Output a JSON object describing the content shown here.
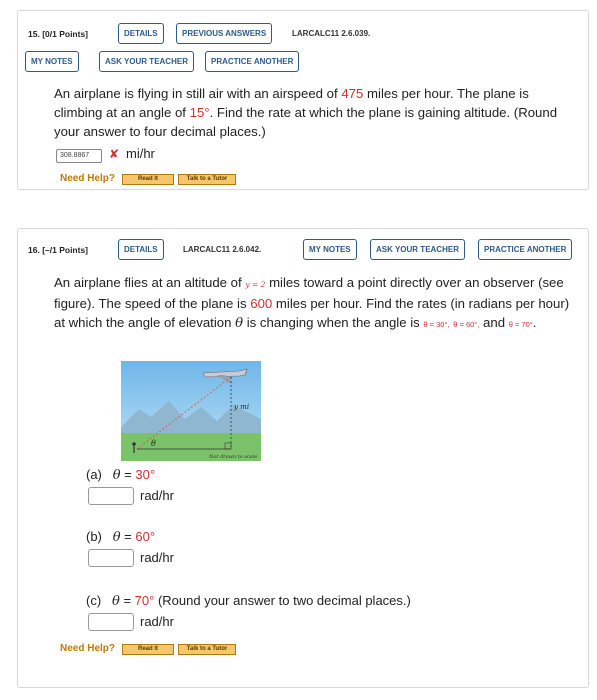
{
  "q15": {
    "number": "15.",
    "points": "[0/1 Points]",
    "buttons": {
      "details": "DETAILS",
      "previous_answers": "PREVIOUS ANSWERS",
      "my_notes": "MY NOTES",
      "ask_teacher": "ASK YOUR TEACHER",
      "practice_another": "PRACTICE ANOTHER"
    },
    "code": "LARCALC11 2.6.039.",
    "text": {
      "p1": "An airplane is flying in still air with an airspeed of ",
      "speed": "475",
      "p2": " miles per hour. The plane is climbing at an angle of ",
      "angle": "15°",
      "p3": ". Find the rate at which the plane is gaining altitude. (Round your answer to four decimal places.)"
    },
    "answer_value": "308.8867",
    "wrong_mark": "✘",
    "unit": "mi/hr",
    "need_help": "Need Help?",
    "read_it": "Read It",
    "talk_tutor": "Talk to a Tutor"
  },
  "q16": {
    "number": "16.",
    "points": "[–/1 Points]",
    "buttons": {
      "details": "DETAILS",
      "my_notes": "MY NOTES",
      "ask_teacher": "ASK YOUR TEACHER",
      "practice_another": "PRACTICE ANOTHER"
    },
    "code": "LARCALC11 2.6.042.",
    "text": {
      "p1": "An airplane flies at an altitude of ",
      "alt_eq": "y = 2",
      "p2": " miles toward a point directly over an observer (see figure). The speed of the plane is ",
      "speed": "600",
      "p3": " miles per hour. Find the rates (in radians per hour) at which the angle of elevation ",
      "theta": "θ",
      "p4": " is changing when the angle is ",
      "a1": "θ = 30°,",
      "a2": "θ = 60°,",
      "and": " and ",
      "a3": "θ = 70°",
      "dot": "."
    },
    "figure": {
      "y_label": "y mi",
      "theta_label": "θ",
      "note": "Not drawn to scale"
    },
    "parts": [
      {
        "label": "(a)",
        "theta": "θ",
        "eq": " = ",
        "value": "30°",
        "extra": "",
        "unit": "rad/hr"
      },
      {
        "label": "(b)",
        "theta": "θ",
        "eq": " = ",
        "value": "60°",
        "extra": "",
        "unit": "rad/hr"
      },
      {
        "label": "(c)",
        "theta": "θ",
        "eq": " = ",
        "value": "70°",
        "extra": " (Round your answer to two decimal places.)",
        "unit": "rad/hr"
      }
    ],
    "need_help": "Need Help?",
    "read_it": "Read It",
    "talk_tutor": "Talk to a Tutor"
  },
  "colors": {
    "accent": "#2c5b8a",
    "highlight": "#d32f2f",
    "help": "#c07a00"
  }
}
